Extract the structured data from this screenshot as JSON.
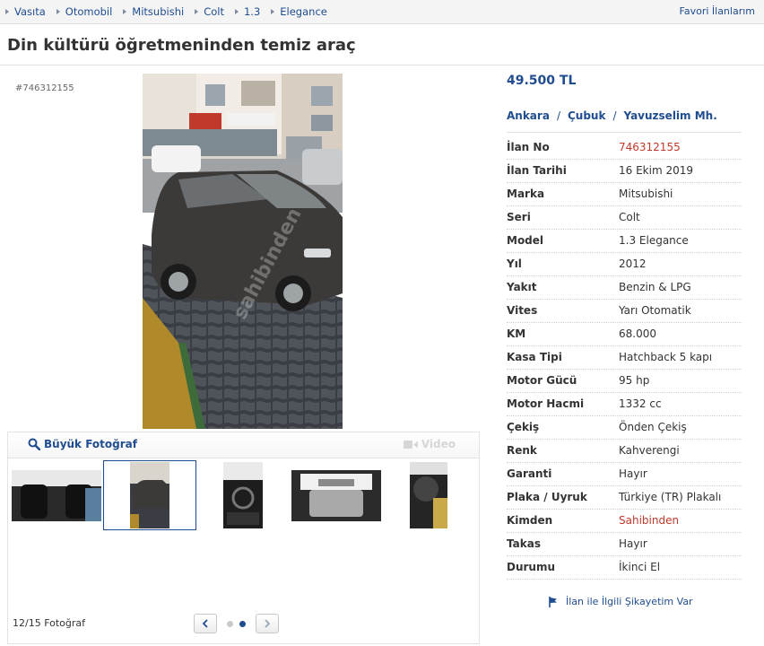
{
  "breadcrumb": [
    "Vasıta",
    "Otomobil",
    "Mitsubishi",
    "Colt",
    "1.3",
    "Elegance"
  ],
  "favorites_link": "Favori İlanlarım",
  "title": "Din kültürü öğretmeninden temiz araç",
  "listing_code": "#746312155",
  "photo_bar": {
    "big_photo_label": "Büyük Fotoğraf",
    "video_label": "Video"
  },
  "gallery": {
    "count_label": "12/15 Fotoğraf",
    "current_page": 2,
    "total_pages": 2
  },
  "watermark": "sahibinden",
  "price": "49.500 TL",
  "location": [
    "Ankara",
    "Çubuk",
    "Yavuzselim Mh."
  ],
  "details": [
    {
      "label": "İlan No",
      "value": "746312155",
      "highlight": true
    },
    {
      "label": "İlan Tarihi",
      "value": "16 Ekim 2019"
    },
    {
      "label": "Marka",
      "value": "Mitsubishi"
    },
    {
      "label": "Seri",
      "value": "Colt"
    },
    {
      "label": "Model",
      "value": "1.3 Elegance"
    },
    {
      "label": "Yıl",
      "value": "2012"
    },
    {
      "label": "Yakıt",
      "value": "Benzin & LPG"
    },
    {
      "label": "Vites",
      "value": "Yarı Otomatik"
    },
    {
      "label": "KM",
      "value": "68.000"
    },
    {
      "label": "Kasa Tipi",
      "value": "Hatchback 5 kapı"
    },
    {
      "label": "Motor Gücü",
      "value": "95 hp"
    },
    {
      "label": "Motor Hacmi",
      "value": "1332 cc"
    },
    {
      "label": "Çekiş",
      "value": "Önden Çekiş"
    },
    {
      "label": "Renk",
      "value": "Kahverengi"
    },
    {
      "label": "Garanti",
      "value": "Hayır"
    },
    {
      "label": "Plaka / Uyruk",
      "value": "Türkiye (TR) Plakalı"
    },
    {
      "label": "Kimden",
      "value": "Sahibinden",
      "highlight": true
    },
    {
      "label": "Takas",
      "value": "Hayır"
    },
    {
      "label": "Durumu",
      "value": "İkinci El"
    }
  ],
  "complaint_link": "İlan ile İlgili Şikayetim Var",
  "colors": {
    "link": "#1f4d8f",
    "highlight": "#c0392b"
  }
}
